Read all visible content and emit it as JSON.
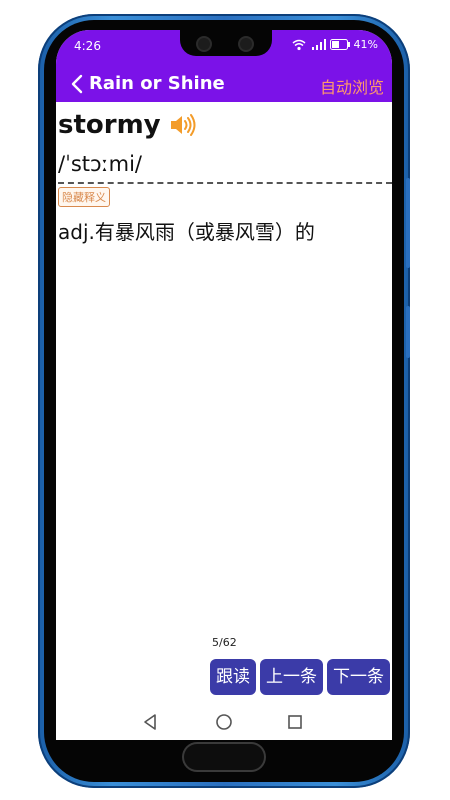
{
  "status_bar": {
    "time": "4:26",
    "battery": "41%"
  },
  "header": {
    "title": "Rain or Shine",
    "auto_browse_label": "自动浏览"
  },
  "entry": {
    "word": "stormy",
    "phonetic": "/ˈstɔːmi/",
    "hide_meaning_label": "隐藏释义",
    "definition": "adj.有暴风雨（或暴风雪）的"
  },
  "pager": {
    "counter": "5/62"
  },
  "actions": {
    "follow_read_label": "跟读",
    "prev_label": "上一条",
    "next_label": "下一条"
  },
  "colors": {
    "header_bg": "#7b12e8",
    "accent_orange": "#ff9a6a",
    "button_bg": "#3b3ba8"
  }
}
